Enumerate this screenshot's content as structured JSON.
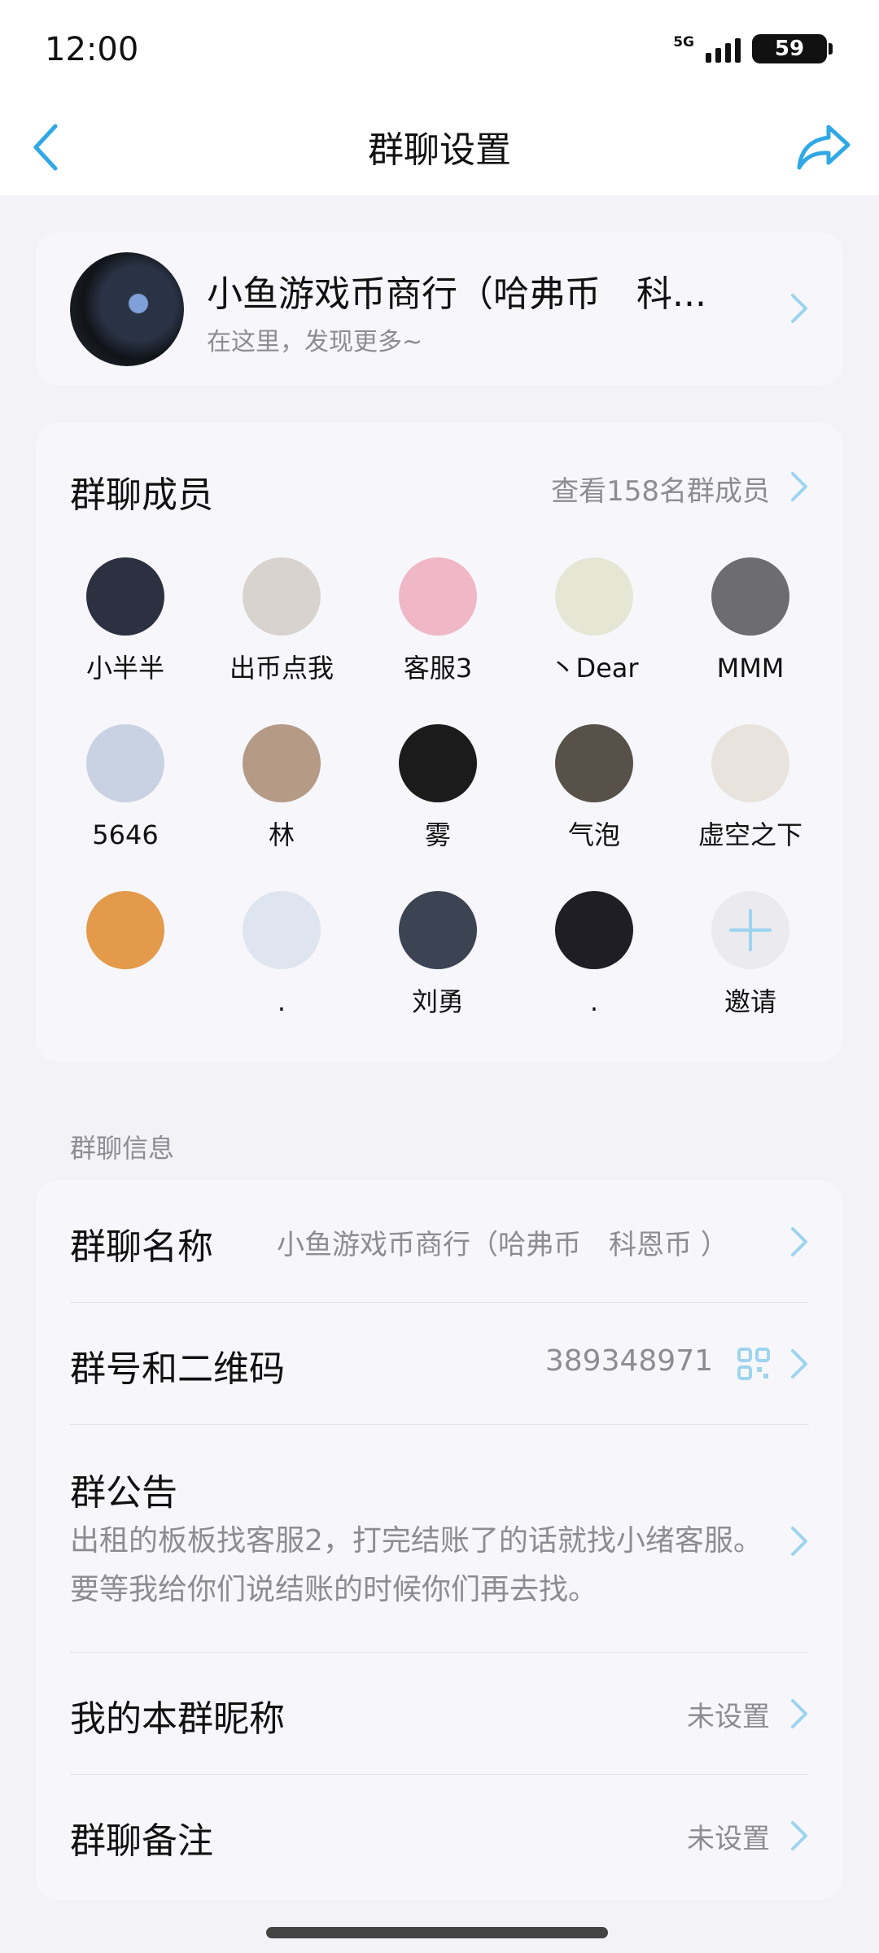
{
  "status_bar": {
    "time": "12:00",
    "network": "5G",
    "battery": "59"
  },
  "nav": {
    "title": "群聊设置",
    "back_icon": "chevron-left-icon",
    "share_icon": "share-arrow-icon"
  },
  "group": {
    "name": "小鱼游戏币商行（哈弗币　科...",
    "subtitle": "在这里，发现更多~"
  },
  "members": {
    "title": "群聊成员",
    "view_all": "查看158名群成员",
    "list": [
      {
        "name": "小半半",
        "color": "#2b3140"
      },
      {
        "name": "出币点我",
        "color": "#d9d3cf"
      },
      {
        "name": "客服3",
        "color": "#f0b7c6"
      },
      {
        "name": "丶Dear",
        "color": "#e5e6d4"
      },
      {
        "name": "MMM",
        "color": "#6d6d70"
      },
      {
        "name": "5646",
        "color": "#c9d2e3"
      },
      {
        "name": "林",
        "color": "#b59a86"
      },
      {
        "name": "雾",
        "color": "#1b1b1b"
      },
      {
        "name": "气泡",
        "color": "#58514a"
      },
      {
        "name": "虚空之下",
        "color": "#e9e3de"
      },
      {
        "name": "",
        "color": "#e39a4b"
      },
      {
        "name": ".",
        "color": "#dfe5ee"
      },
      {
        "name": "刘勇",
        "color": "#3c4454"
      },
      {
        "name": ".",
        "color": "#1e1e24"
      }
    ],
    "invite_label": "邀请"
  },
  "info_section": {
    "label": "群聊信息",
    "name_label": "群聊名称",
    "name_value": "小鱼游戏币商行（哈弗币　科恩币 ）",
    "id_label": "群号和二维码",
    "id_value": "389348971",
    "notice_label": "群公告",
    "notice_text": "出租的板板找客服2，打完结账了的话就找小绪客服。要等我给你们说结账的时候你们再去找。",
    "nickname_label": "我的本群昵称",
    "nickname_value": "未设置",
    "remark_label": "群聊备注",
    "remark_value": "未设置"
  },
  "colors": {
    "accent": "#2fa8e6",
    "chevron": "#9dd4ef",
    "muted_text": "#8c8c92"
  }
}
